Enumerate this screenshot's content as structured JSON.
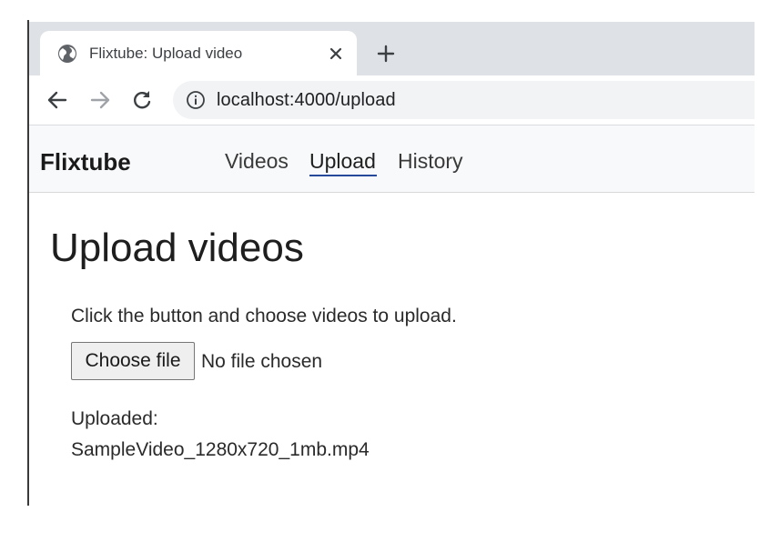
{
  "browser": {
    "tab": {
      "title": "Flixtube: Upload video",
      "icon": "globe-icon",
      "close_icon": "close-icon"
    },
    "new_tab_icon": "plus-icon",
    "toolbar": {
      "back_icon": "arrow-left-icon",
      "forward_icon": "arrow-right-icon",
      "reload_icon": "reload-icon",
      "site_info_icon": "info-icon",
      "url": "localhost:4000/upload"
    }
  },
  "navbar": {
    "brand": "Flixtube",
    "links": [
      {
        "label": "Videos",
        "active": false
      },
      {
        "label": "Upload",
        "active": true
      },
      {
        "label": "History",
        "active": false
      }
    ],
    "active_color": "#26499a"
  },
  "main": {
    "title": "Upload videos",
    "instructions": "Click the button and choose videos to upload.",
    "file_input": {
      "button_label": "Choose file",
      "status": "No file chosen"
    },
    "uploaded": {
      "label": "Uploaded:",
      "files": [
        "SampleVideo_1280x720_1mb.mp4"
      ]
    }
  }
}
